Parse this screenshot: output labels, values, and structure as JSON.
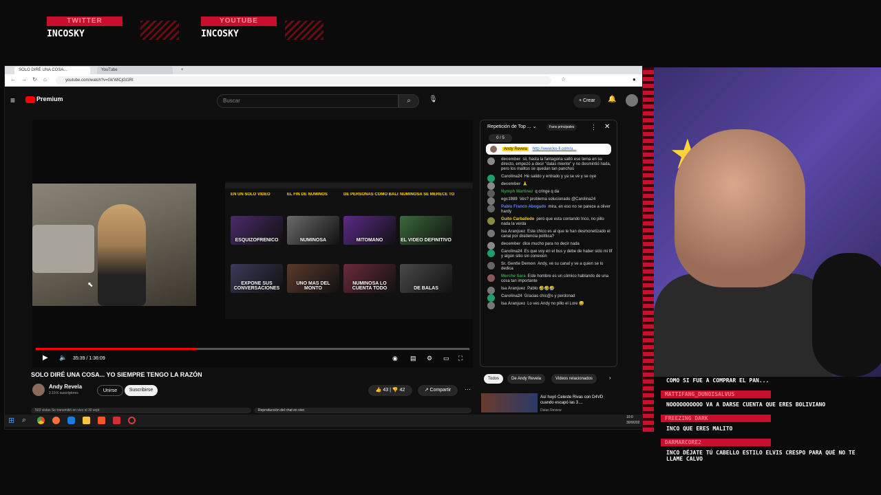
{
  "overlay": {
    "twitter_label": "TWITTER",
    "twitter_name": "INCOSKY",
    "youtube_label": "YOUTUBE",
    "youtube_name": "INCOSKY"
  },
  "browser": {
    "tab_active": "SOLO DIRÉ UNA COSA...",
    "tab_2": "YouTube",
    "url": "youtube.com/watch?v=Gk'WlCjGt1RI"
  },
  "youtube": {
    "logo": "Premium",
    "search_placeholder": "Buscar",
    "create_label": "Crear"
  },
  "player": {
    "time": "35:39 / 1:36:09",
    "progress": 0.37,
    "shot_labels": [
      "ESQUIZOFRENICO",
      "NUMINOSA",
      "MITOMANO",
      "EL VIDEO DEFINITIVO",
      "EXPONE SUS CONVERSACIONES",
      "UNO MAS DEL MONTO",
      "NUMINOSA LO CUENTA TODO",
      "DE BALAS"
    ],
    "shot_headers": [
      "EN UN SOLO VIDEO",
      "EL FIN DE NUMINOS",
      "DE PERSONAS COMO BALI",
      "NUMINOSA SE MERECE TO"
    ]
  },
  "video": {
    "title": "SOLO DIRÉ UNA COSA... YO SIEMPRE TENGO LA RAZÓN",
    "channel": "Andy Revela",
    "subscribers": "2.19 K suscriptores",
    "join_label": "Unirse",
    "subscribe_label": "Suscribirse",
    "likes": "43",
    "dislikes": "42",
    "share_label": "Compartir"
  },
  "chat": {
    "header": "Repetición de Top ...",
    "badge": "Fans principales",
    "counter": "0 / 5",
    "pinned_author": "Andy Revela",
    "pinned_link": "http://www.ko-fi.com/a...",
    "messages": [
      {
        "author": "december",
        "text": "sii, hasta la fantagoria saltó ese tema en su directo, empezó a decir \"dalas miente\" y no desmintió nada, pero los malitos se quedan tan panchos",
        "color": "#aaaaaa",
        "av": "#888888"
      },
      {
        "author": "Carolina24",
        "text": "He salido y entrado y ya se ve y se oye",
        "color": "#aaaaaa",
        "av": "#1e9e6a"
      },
      {
        "author": "december",
        "text": "🙏",
        "color": "#aaaaaa",
        "av": "#888888"
      },
      {
        "author": "Nymph Martinez",
        "text": "q cringe q da",
        "color": "#2ba640",
        "av": "#5a5a5a"
      },
      {
        "author": "egc1989",
        "text": "Ves? problema solucionado @Carolina24",
        "color": "#aaaaaa",
        "av": "#777777"
      },
      {
        "author": "Pablo Franco Abogado",
        "text": "mira, en eso no se parece a oliver hardy",
        "color": "#5e84f1",
        "av": "#666666"
      },
      {
        "author": "Guito Carballedo",
        "text": "pero que esta contando Inco, no pillo nada la verda",
        "color": "#ffd600",
        "av": "#8a8a3a"
      },
      {
        "author": "Isa Aranjuez",
        "text": "Este chico es al que le han desmonetizado el canal por disidencia política?",
        "color": "#aaaaaa",
        "av": "#777777"
      },
      {
        "author": "december",
        "text": "dice mucho para no decir nada",
        "color": "#aaaaaa",
        "av": "#888888"
      },
      {
        "author": "Carolina24",
        "text": "Es que voy en el bus y debe de haber sido mi tlf y algún sitio sin conexion",
        "color": "#aaaaaa",
        "av": "#1e9e6a"
      },
      {
        "author": "Sr. Gentle Demon",
        "text": "Andy, ve su canal y ve a quien se lo dedica",
        "color": "#aaaaaa",
        "av": "#666666"
      },
      {
        "author": "Merche Sara",
        "text": "Este hombre es un cómico hablando de una cosa tan importante",
        "color": "#2ba640",
        "av": "#8a5a5a"
      },
      {
        "author": "Isa Aranjuez",
        "text": "Pablo 🤣🤣🤣",
        "color": "#aaaaaa",
        "av": "#777777"
      },
      {
        "author": "Carolina24",
        "text": "Gracias chic@s y perdonad",
        "color": "#aaaaaa",
        "av": "#1e9e6a"
      },
      {
        "author": "Isa Aranjuez",
        "text": "Lo ves Andy no pillo el Lore 😅",
        "color": "#aaaaaa",
        "av": "#777777"
      }
    ],
    "chips": [
      "Todos",
      "De Andy Revela",
      "Videos relacionados"
    ],
    "related_title": "Así huyó Celeste Rivas con D4VD cuando escapó las 3 ...",
    "related_channel": "Dalas Review"
  },
  "below": {
    "views": "503 vistas  Se transmitió en vivo el 30 sept",
    "replay": "Reproducción del chat en vivo"
  },
  "taskbar": {
    "time": "10:0",
    "date": "30/9/202"
  },
  "stream_chat": [
    {
      "user": "",
      "text": "COMO SI FUE A COMPRAR EL PAN..."
    },
    {
      "user": "MATTIFANG_DUNOISALVUS",
      "text": "NOOOOOOOOOO VA A DARSE CUENTA QUE ERES BOLIVIANO"
    },
    {
      "user": "FREEZING DARK",
      "text": "INCO QUE ERES MALITO"
    },
    {
      "user": "DARMARCORE2",
      "text": "INCO DÉJATE TÚ CABELLO ESTILO ELVIS CRESPO PARA QUÉ NO TE LLAME CALVO"
    }
  ],
  "colors": {
    "accent": "#c8102e",
    "yt_red": "#ff0000"
  }
}
